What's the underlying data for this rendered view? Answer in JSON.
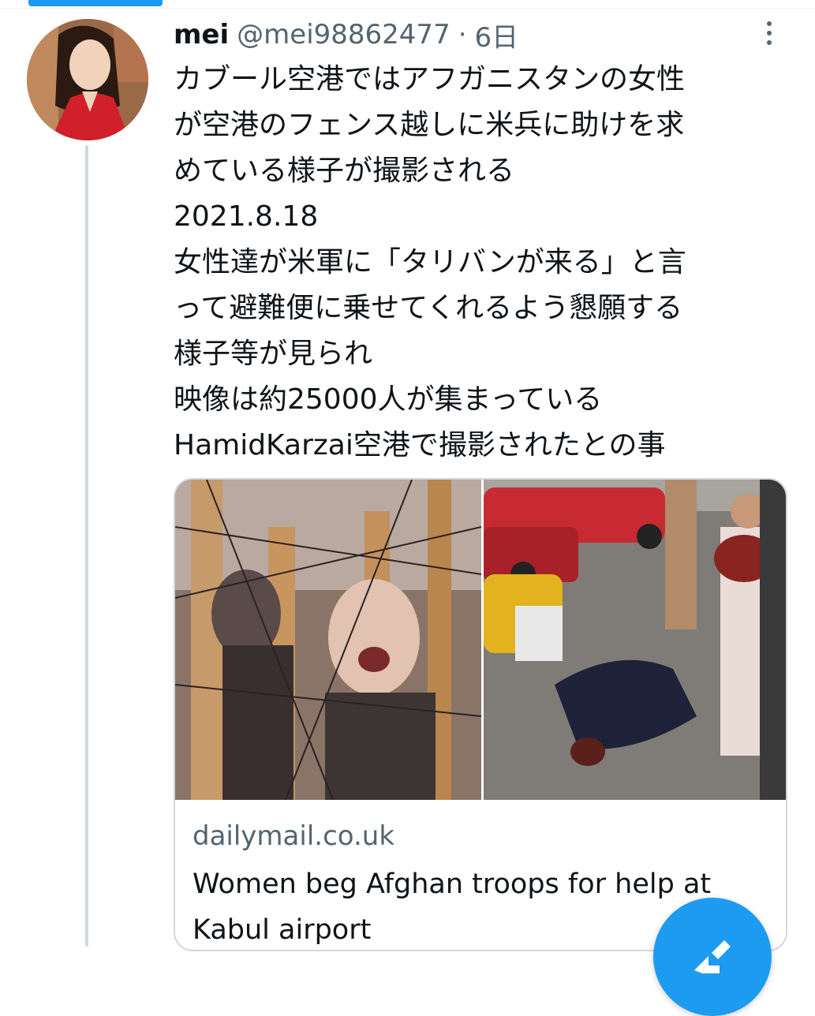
{
  "tweet": {
    "display_name": "mei",
    "handle": "@mei98862477",
    "separator": "·",
    "time": "6日",
    "text_lines": [
      "カブール空港ではアフガニスタンの女性",
      "が空港のフェンス越しに米兵に助けを求",
      "めている様子が撮影される",
      "2021.8.18",
      "女性達が米軍に「タリバンが来る」と言",
      "って避難便に乗せてくれるよう懇願する",
      "様子等が見られ",
      "映像は約25000人が集まっている",
      "HamidKarzai空港で撮影されたとの事"
    ]
  },
  "card": {
    "domain": "dailymail.co.uk",
    "title": "Women beg Afghan troops for help at Kabul airport"
  },
  "icons": {
    "more": "more-vertical-icon",
    "compose": "compose-tweet-icon"
  },
  "colors": {
    "accent": "#1d9bf0",
    "secondary_text": "#536471",
    "border": "#cfd9de"
  }
}
